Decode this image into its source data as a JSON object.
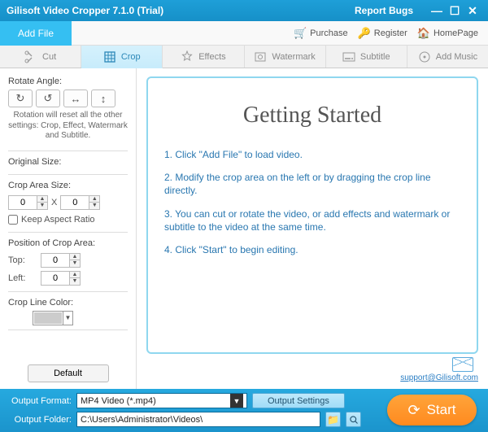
{
  "titlebar": {
    "title": "Gilisoft Video Cropper 7.1.0 (Trial)",
    "report": "Report Bugs"
  },
  "topbar": {
    "addfile": "Add File",
    "purchase": "Purchase",
    "register": "Register",
    "homepage": "HomePage"
  },
  "tabs": {
    "cut": "Cut",
    "crop": "Crop",
    "effects": "Effects",
    "watermark": "Watermark",
    "subtitle": "Subtitle",
    "addmusic": "Add Music"
  },
  "sidebar": {
    "rotate_label": "Rotate Angle:",
    "rotate_note": "Rotation will reset all the other settings: Crop, Effect, Watermark and Subtitle.",
    "original_size": "Original Size:",
    "crop_area_size": "Crop Area Size:",
    "size_w": "0",
    "size_x": "X",
    "size_h": "0",
    "keep_aspect": "Keep Aspect Ratio",
    "pos_label": "Position of Crop Area:",
    "top_label": "Top:",
    "top_val": "0",
    "left_label": "Left:",
    "left_val": "0",
    "cropline_color": "Crop Line Color:",
    "default_btn": "Default"
  },
  "content": {
    "heading": "Getting Started",
    "step1": "1. Click \"Add File\" to load video.",
    "step2": "2. Modify the crop area on the left or by dragging the crop line directly.",
    "step3": "3. You can cut or rotate the video, or add effects and watermark or subtitle to the video at the same time.",
    "step4": "4. Click \"Start\" to begin editing.",
    "support": "support@Gilisoft.com"
  },
  "footer": {
    "format_label": "Output Format:",
    "format_value": "MP4 Video (*.mp4)",
    "settings_btn": "Output Settings",
    "folder_label": "Output Folder:",
    "folder_value": "C:\\Users\\Administrator\\Videos\\",
    "start": "Start"
  }
}
